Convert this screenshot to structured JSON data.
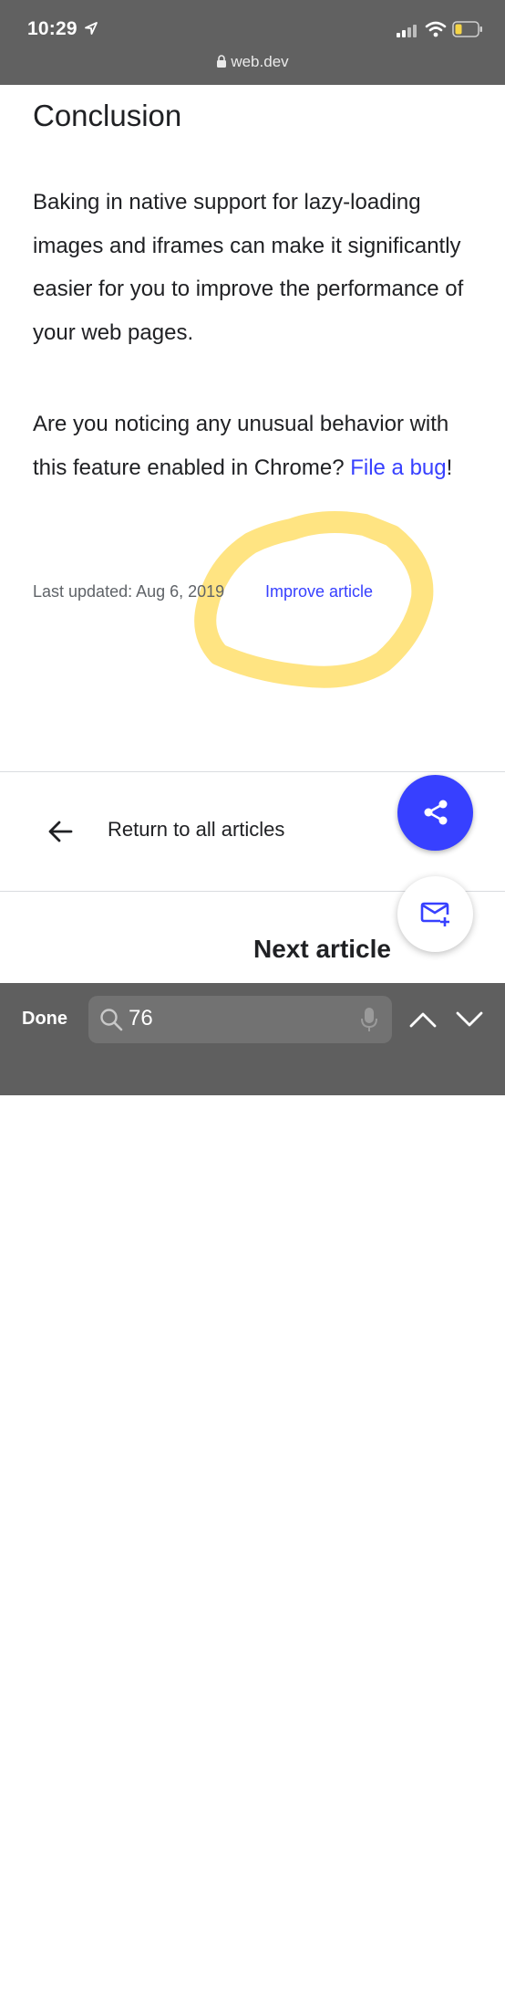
{
  "status_bar": {
    "time": "10:29"
  },
  "url_bar": {
    "domain": "web.dev"
  },
  "article": {
    "heading": "Conclusion",
    "paragraph1": "Baking in native support for lazy-loading images and iframes can make it significantly easier for you to improve the performance of your web pages.",
    "paragraph2_text": "Are you noticing any unusual behavior with this feature enabled in Chrome? ",
    "paragraph2_link": "File a bug",
    "paragraph2_end": "!",
    "last_updated": "Last updated: Aug 6, 2019",
    "improve_link": "Improve article"
  },
  "footer_nav": {
    "return_label": "Return to all articles",
    "next_article_label": "Next article"
  },
  "find_bar": {
    "done_label": "Done",
    "query": "76"
  },
  "colors": {
    "link": "#3740ff",
    "fab": "#3740ff",
    "highlight": "#ffd84d",
    "toolbar": "#616161"
  }
}
